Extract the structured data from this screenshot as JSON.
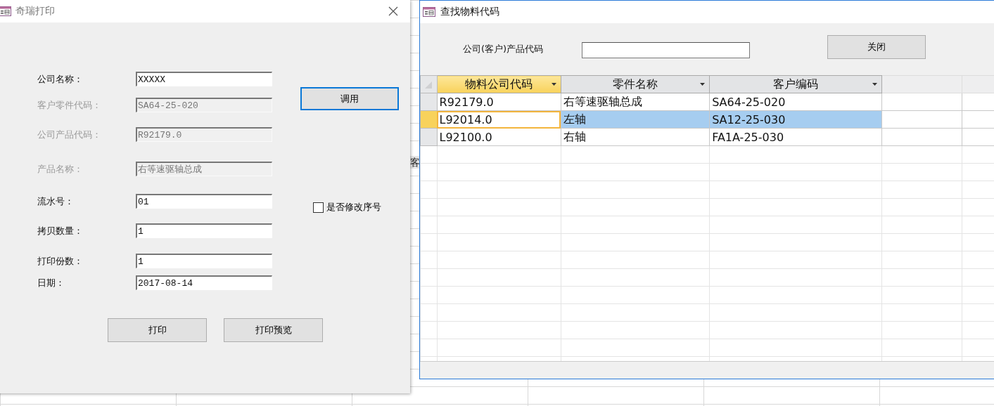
{
  "background_sheet": {
    "header_fragment": "客"
  },
  "print_window": {
    "title": "奇瑞打印",
    "fields": [
      {
        "label": "公司名称：",
        "value": "XXXXX",
        "disabled": false
      },
      {
        "label": "客户零件代码：",
        "value": "SA64-25-020",
        "disabled": true
      },
      {
        "label": "公司产品代码：",
        "value": "R92179.0",
        "disabled": true
      },
      {
        "label": "产品名称：",
        "value": "右等速驱轴总成",
        "disabled": true
      },
      {
        "label": "流水号：",
        "value": "01",
        "disabled": false
      },
      {
        "label": "拷贝数量：",
        "value": "1",
        "disabled": false
      },
      {
        "label": "打印份数：",
        "value": "1",
        "disabled": false
      },
      {
        "label": "日期：",
        "value": "2017-08-14",
        "disabled": false
      }
    ],
    "call_button": {
      "label": "调用",
      "focused": true
    },
    "checkbox": {
      "label": "是否修改序号",
      "checked": false
    },
    "buttons": [
      {
        "label": "打印"
      },
      {
        "label": "打印预览"
      }
    ]
  },
  "find_window": {
    "title": "查找物料代码",
    "search": {
      "label": "公司(客户)产品代码"
    },
    "close_button": {
      "label": "关闭"
    },
    "table": {
      "columns": [
        {
          "label": "物料公司代码",
          "selected": true
        },
        {
          "label": "零件名称",
          "selected": false
        },
        {
          "label": "客户编码",
          "selected": false
        }
      ],
      "rows": [
        {
          "cells": [
            "R92179.0",
            "右等速驱轴总成",
            "SA64-25-020"
          ],
          "selected": false
        },
        {
          "cells": [
            "L92014.0",
            "左轴",
            "SA12-25-030"
          ],
          "selected": true
        },
        {
          "cells": [
            "L92100.0",
            "右轴",
            "FA1A-25-030"
          ],
          "selected": false
        }
      ]
    }
  }
}
